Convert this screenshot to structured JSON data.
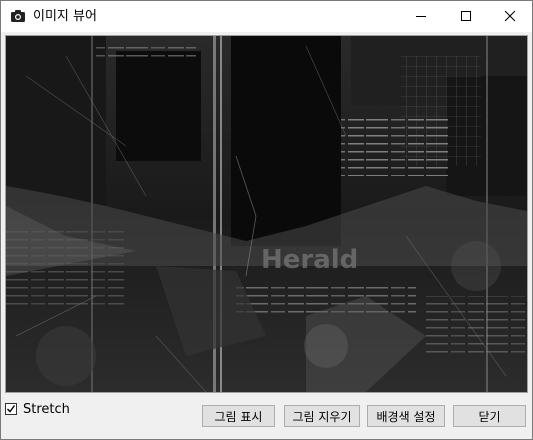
{
  "window": {
    "title": "이미지 뷰어",
    "icon": "camera-icon",
    "controls": [
      "minimize-icon",
      "maximize-icon",
      "close-icon"
    ]
  },
  "image": {
    "description_visible_words": "Herald"
  },
  "options": {
    "stretch_label": "Stretch",
    "stretch_checked": true
  },
  "buttons": {
    "show_picture": "그림 표시",
    "clear_picture": "그림 지우기",
    "background_color": "배경색 설정",
    "close": "닫기"
  }
}
